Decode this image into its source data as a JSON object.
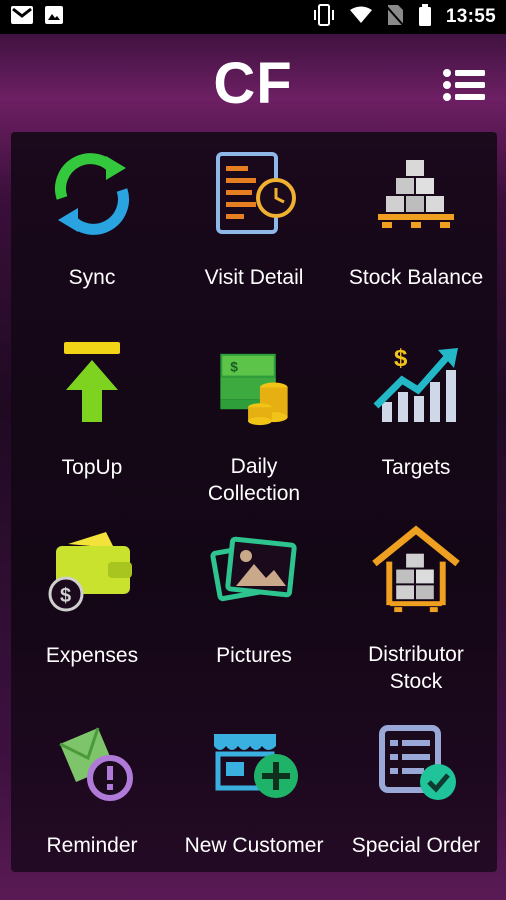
{
  "status_bar": {
    "time": "13:55"
  },
  "header": {
    "title": "CF"
  },
  "tiles": [
    {
      "label": "Sync"
    },
    {
      "label": "Visit Detail"
    },
    {
      "label": "Stock Balance"
    },
    {
      "label": "TopUp"
    },
    {
      "label": "Daily\nCollection"
    },
    {
      "label": "Targets"
    },
    {
      "label": "Expenses"
    },
    {
      "label": "Pictures"
    },
    {
      "label": "Distributor\nStock"
    },
    {
      "label": "Reminder"
    },
    {
      "label": "New Customer"
    },
    {
      "label": "Special Order"
    }
  ],
  "icons": [
    "sync-icon",
    "visit-detail-icon",
    "stock-balance-icon",
    "topup-icon",
    "daily-collection-icon",
    "targets-icon",
    "expenses-icon",
    "pictures-icon",
    "distributor-stock-icon",
    "reminder-icon",
    "new-customer-icon",
    "special-order-icon"
  ],
  "colors": {
    "accent_green": "#2ecc40",
    "accent_blue": "#2aa4e0",
    "accent_yellow": "#f2c417",
    "accent_purple": "#8e44ad",
    "accent_teal": "#1fb58f"
  }
}
